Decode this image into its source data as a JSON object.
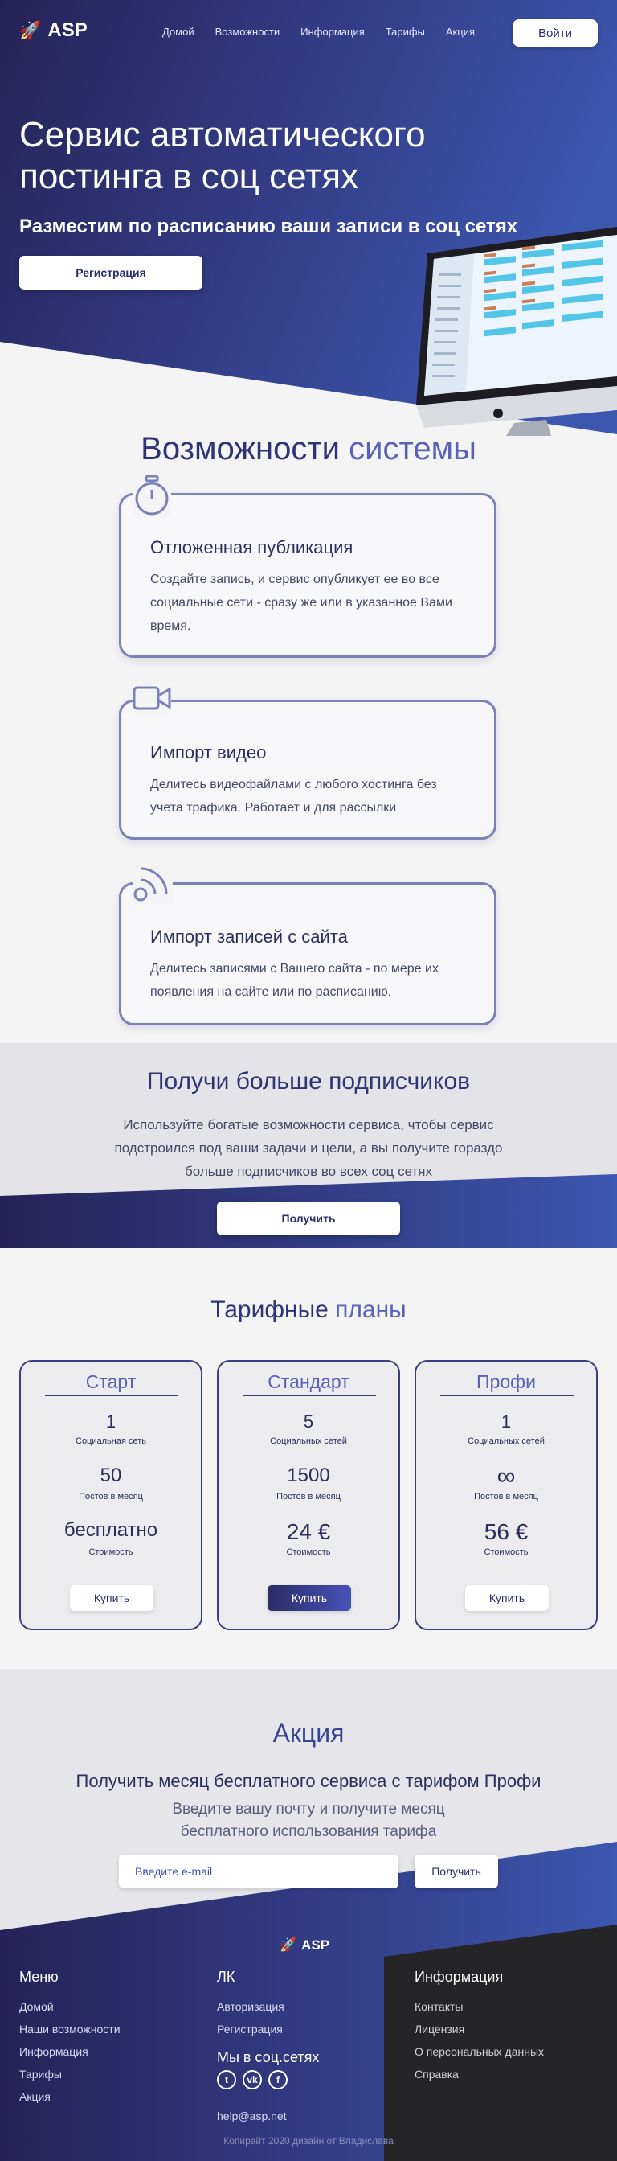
{
  "brand": {
    "name": "ASP",
    "logo_icon": "rocket-icon"
  },
  "nav": {
    "links": [
      "Домой",
      "Возможности",
      "Информация",
      "Тарифы",
      "Акция"
    ],
    "login_label": "Войти"
  },
  "hero": {
    "title": "Сервис автоматического постинга в соц сетях",
    "subtitle": "Разместим по расписанию ваши записи в соц сетях",
    "register_label": "Регистрация"
  },
  "features": {
    "title_main": "Возможности",
    "title_accent": " системы",
    "items": [
      {
        "icon": "stopwatch-icon",
        "title": "Отложенная публикация",
        "text": "Создайте запись, и сервис опубликует ее во все социальные сети - сразу же или в указанное Вами время."
      },
      {
        "icon": "video-camera-icon",
        "title": "Импорт видео",
        "text": "Делитесь видеофайлами с любого хостинга без учета трафика. Работает и для рассылки"
      },
      {
        "icon": "rss-icon",
        "title": "Импорт записей с сайта",
        "text": "Делитесь записями с Вашего сайта - по мере их появления на сайте или по расписанию."
      }
    ]
  },
  "subscribers": {
    "title": "Получи больше подписчиков",
    "text": "Используйте богатые возможности сервиса, чтобы сервис подстроился под ваши задачи и цели, а вы получите гораздо больше подписчиков во всех соц сетях",
    "button_label": "Получить"
  },
  "pricing": {
    "title_main": "Тарифные",
    "title_accent": " планы",
    "plans": [
      {
        "name": "Старт",
        "networks": "1",
        "networks_label": "Социальная сеть",
        "posts": "50",
        "posts_label": "Постов в месяц",
        "price": "бесплатно",
        "price_label": "Стоимость",
        "button_label": "Купить",
        "highlighted": false
      },
      {
        "name": "Стандарт",
        "networks": "5",
        "networks_label": "Социальных сетей",
        "posts": "1500",
        "posts_label": "Постов в месяц",
        "price": "24 €",
        "price_label": "Стоимость",
        "button_label": "Купить",
        "highlighted": true
      },
      {
        "name": "Профи",
        "networks": "1",
        "networks_label": "Социальных сетей",
        "posts": "∞",
        "posts_label": "Постов в месяц",
        "price": "56 €",
        "price_label": "Стоимость",
        "button_label": "Купить",
        "highlighted": false
      }
    ]
  },
  "promo": {
    "title": "Акция",
    "headline": "Получить месяц бесплатного сервиса с тарифом Профи",
    "text": "Введите вашу почту и получите месяц бесплатного использования тарифа",
    "email_placeholder": "Введите e-mail",
    "button_label": "Получить"
  },
  "footer": {
    "brand": "ASP",
    "menu": {
      "title": "Меню",
      "links": [
        "Домой",
        "Наши возможности",
        "Информация",
        "Тарифы",
        "Акция"
      ]
    },
    "account": {
      "title": "ЛК",
      "links": [
        "Авторизация",
        "Регистрация"
      ],
      "social_title": "Мы в соц.сетях",
      "social_icons": [
        "twitter-icon",
        "vk-icon",
        "facebook-icon"
      ],
      "email": "help@asp.net"
    },
    "info": {
      "title": "Информация",
      "links": [
        "Контакты",
        "Лицензия",
        "О персональных данных",
        "Справка"
      ]
    },
    "copyright": "Копирайт 2020 дизайн от Владислава"
  },
  "colors": {
    "brand_dark": "#252659",
    "brand_blue": "#3f55b0",
    "text": "#2b2e5c",
    "background": "#f4f4f5",
    "footer_dark": "#252528"
  }
}
